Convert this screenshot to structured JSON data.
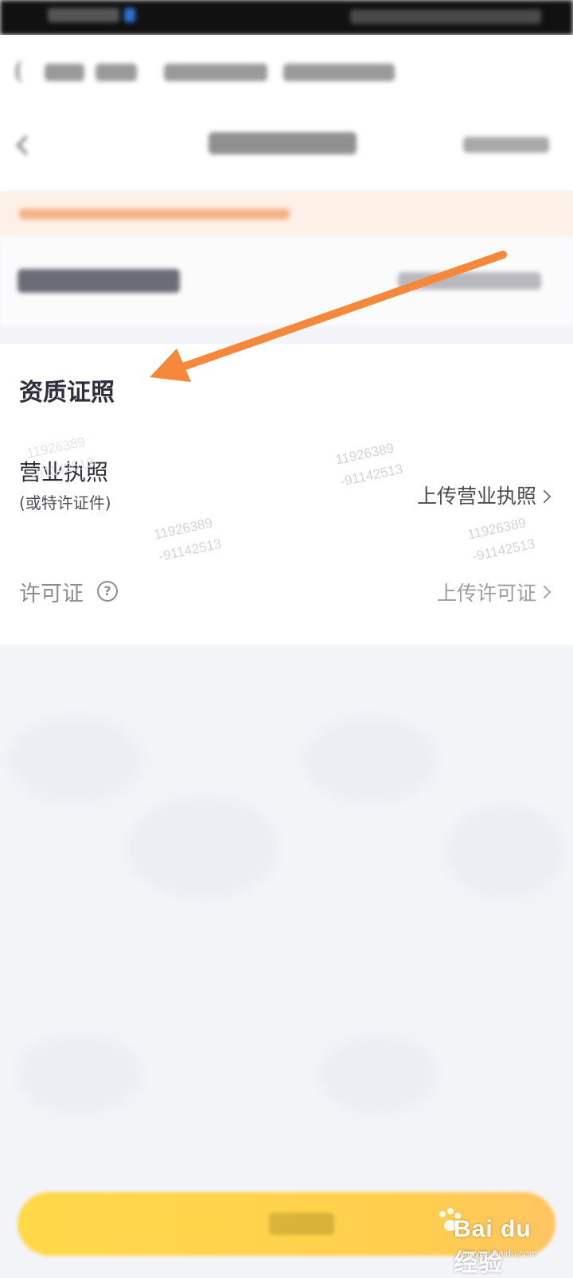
{
  "section": {
    "title": "资质证照"
  },
  "business_license": {
    "label": "营业执照",
    "sublabel": "(或特许证件)",
    "action": "上传营业执照"
  },
  "permit": {
    "label": "许可证",
    "action": "上传许可证"
  },
  "watermarks": [
    {
      "line1": "11926389",
      "line2": "-91142513"
    },
    {
      "line1": "11926389",
      "line2": "-91142513"
    },
    {
      "line1": "11926389",
      "line2": "-91142513"
    },
    {
      "line1": "11926389",
      "line2": "-91142513"
    }
  ],
  "logo": {
    "text": "Bai du 经验",
    "subtext": "jingyan.baidu.com"
  },
  "colors": {
    "arrow": "#f5883a",
    "button": "#ffd54a",
    "notice_bg": "#fdf0e6"
  },
  "icons": {
    "help": "?"
  }
}
